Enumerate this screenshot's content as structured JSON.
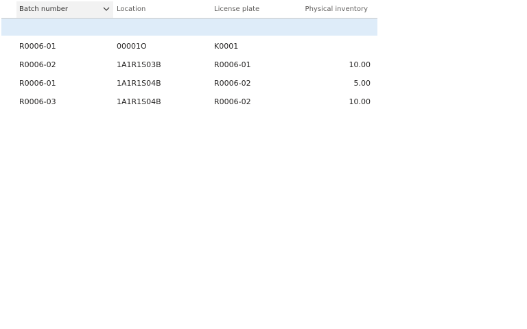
{
  "grid": {
    "columns": {
      "batch": "Batch number",
      "location": "Location",
      "license_plate": "License plate",
      "physical_inventory": "Physical inventory"
    },
    "rows": [
      {
        "batch": "R0006-01",
        "location": "00001O",
        "license_plate": "K0001",
        "physical_inventory": ""
      },
      {
        "batch": "R0006-02",
        "location": "1A1R1S03B",
        "license_plate": "R0006-01",
        "physical_inventory": "10.00"
      },
      {
        "batch": "R0006-01",
        "location": "1A1R1S04B",
        "license_plate": "R0006-02",
        "physical_inventory": "5.00"
      },
      {
        "batch": "R0006-03",
        "location": "1A1R1S04B",
        "license_plate": "R0006-02",
        "physical_inventory": "10.00"
      }
    ]
  },
  "icons": {
    "sort": "chevron-down-icon"
  },
  "colors": {
    "selected_row": "#deecf9",
    "header_active": "#f2f2f2"
  }
}
